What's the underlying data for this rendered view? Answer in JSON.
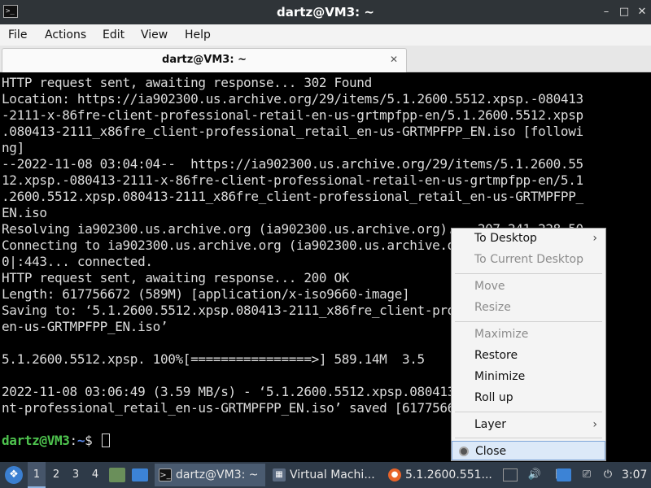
{
  "window": {
    "title": "dartz@VM3: ~",
    "app_icon": ">_",
    "controls": {
      "minimize": "–",
      "maximize": "□",
      "close": "✕"
    }
  },
  "menubar": {
    "items": [
      "File",
      "Actions",
      "Edit",
      "View",
      "Help"
    ]
  },
  "tab": {
    "label": "dartz@VM3: ~",
    "close": "✕"
  },
  "terminal": {
    "lines": [
      "HTTP request sent, awaiting response... 302 Found",
      "Location: https://ia902300.us.archive.org/29/items/5.1.2600.5512.xpsp.-080413",
      "-2111-x-86fre-client-professional-retail-en-us-grtmpfpp-en/5.1.2600.5512.xpsp",
      ".080413-2111_x86fre_client-professional_retail_en-us-GRTMPFPP_EN.iso [followi",
      "ng]",
      "--2022-11-08 03:04:04--  https://ia902300.us.archive.org/29/items/5.1.2600.55",
      "12.xpsp.-080413-2111-x-86fre-client-professional-retail-en-us-grtmpfpp-en/5.1",
      ".2600.5512.xpsp.080413-2111_x86fre_client-professional_retail_en-us-GRTMPFPP_",
      "EN.iso",
      "Resolving ia902300.us.archive.org (ia902300.us.archive.org)... 207.241.228.50",
      "Connecting to ia902300.us.archive.org (ia902300.us.archive.org)|207.241.228.5",
      "0|:443... connected.",
      "HTTP request sent, awaiting response... 200 OK",
      "Length: 617756672 (589M) [application/x-iso9660-image]",
      "Saving to: ‘5.1.2600.5512.xpsp.080413-2111_x86fre_client-professional_retail_",
      "en-us-GRTMPFPP_EN.iso’",
      "",
      "5.1.2600.5512.xpsp. 100%[================>] 589.14M  3.5",
      "",
      "2022-11-08 03:06:49 (3.59 MB/s) - ‘5.1.2600.5512.xpsp.080413-2111_x86fre_clie",
      "nt-professional_retail_en-us-GRTMPFPP_EN.iso’ saved [617756672/617756672]",
      ""
    ],
    "prompt": {
      "user": "dartz@VM3",
      "sep": ":",
      "path": "~",
      "symbol": "$ "
    }
  },
  "context_menu": {
    "items": [
      {
        "label": "To Desktop",
        "enabled": true,
        "submenu": true
      },
      {
        "label": "To Current Desktop",
        "enabled": false
      },
      {
        "label": "Move",
        "enabled": false
      },
      {
        "label": "Resize",
        "enabled": false
      },
      {
        "label": "Maximize",
        "enabled": false
      },
      {
        "label": "Restore",
        "enabled": true
      },
      {
        "label": "Minimize",
        "enabled": true
      },
      {
        "label": "Roll up",
        "enabled": true
      },
      {
        "label": "Layer",
        "enabled": true,
        "submenu": true
      },
      {
        "label": "Close",
        "enabled": true,
        "highlighted": true
      }
    ],
    "submenu_arrow": "›"
  },
  "taskbar": {
    "workspaces": [
      "1",
      "2",
      "3",
      "4"
    ],
    "active_workspace": "1",
    "tasks": [
      {
        "label": "dartz@VM3: ~",
        "icon": "terminal-icon",
        "active": true
      },
      {
        "label": "Virtual Machi...",
        "icon": "virtual-machine-icon",
        "active": false
      },
      {
        "label": "5.1.2600.551...",
        "icon": "firefox-icon",
        "active": false
      }
    ],
    "clock": "3:07"
  }
}
